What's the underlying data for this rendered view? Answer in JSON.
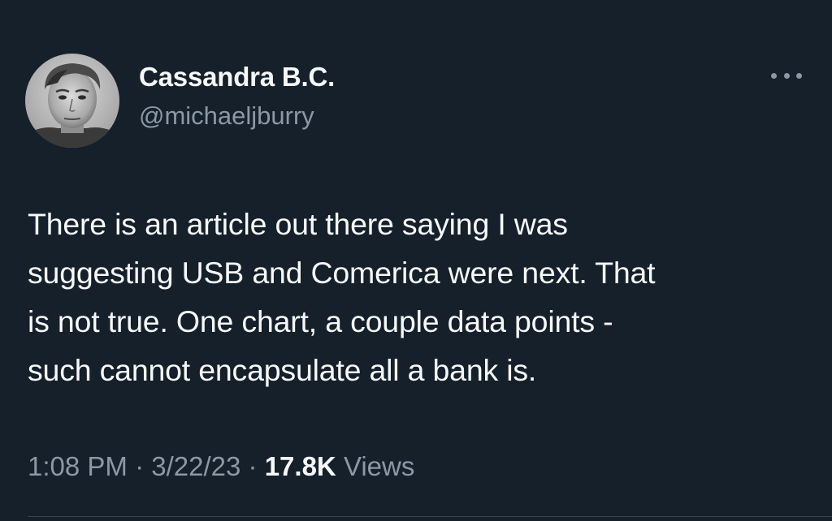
{
  "author": {
    "display_name": "Cassandra B.C.",
    "handle": "@michaeljburry"
  },
  "more_icon": "more-horizontal-icon",
  "tweet": {
    "lines": [
      "There is an article out there saying I was",
      "suggesting USB and Comerica were next. That",
      "is not true. One chart, a couple data points -",
      "such cannot encapsulate all a bank is."
    ]
  },
  "meta": {
    "time": "1:08 PM",
    "separator": "·",
    "date": "3/22/23",
    "views_count": "17.8K",
    "views_label": "Views"
  },
  "colors": {
    "background": "#15202b",
    "text_primary": "#f7f9f9",
    "text_secondary": "#8b98a5",
    "divider": "#38444d"
  }
}
